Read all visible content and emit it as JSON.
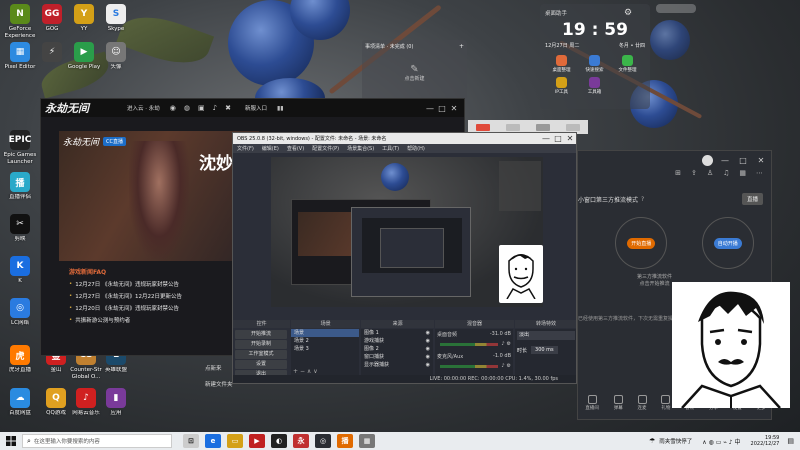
{
  "desktop": {
    "icons": [
      {
        "label": "GeForce\nExperience",
        "glyph": "N",
        "color": "#5a8a1a"
      },
      {
        "label": "GOG",
        "glyph": "GG",
        "color": "#c0202a"
      },
      {
        "label": "YY",
        "glyph": "Y",
        "color": "#d4a017"
      },
      {
        "label": "Skype",
        "glyph": "S",
        "color": "#eee"
      },
      {
        "label": "Pixel Editor",
        "glyph": "▦",
        "color": "#2d8ae0"
      },
      {
        "label": "",
        "glyph": "⚡",
        "color": "#444"
      },
      {
        "label": "Google Play",
        "glyph": "▶",
        "color": "#2a9d4a"
      },
      {
        "label": "头像",
        "glyph": "☺",
        "color": "#777"
      },
      {
        "label": "Epic Games\nLauncher",
        "glyph": "EPIC",
        "color": "#222"
      },
      {
        "label": "直播伴侣",
        "glyph": "播",
        "color": "#2aa9c9"
      },
      {
        "label": "剪映",
        "glyph": "✂",
        "color": "#111"
      },
      {
        "label": "K",
        "glyph": "K",
        "color": "#1a6ee0"
      },
      {
        "label": "LC网络",
        "glyph": "◎",
        "color": "#2a7be0"
      },
      {
        "label": "虎牙直播",
        "glyph": "虎",
        "color": "#ff7a00"
      },
      {
        "label": "金山",
        "glyph": "金",
        "color": "#d02020"
      },
      {
        "label": "Counter-Str\nGlobal O...",
        "glyph": "CS",
        "color": "#c08030"
      },
      {
        "label": "英雄联盟",
        "glyph": "L",
        "color": "#1b4a6b"
      },
      {
        "label": "百度网盘",
        "glyph": "☁",
        "color": "#2a8be0"
      },
      {
        "label": "QQ游戏",
        "glyph": "Q",
        "color": "#e0a020"
      },
      {
        "label": "网易云音乐",
        "glyph": "♪",
        "color": "#d02020"
      },
      {
        "label": "应用",
        "glyph": "▮",
        "color": "#7a3a9a"
      }
    ]
  },
  "clock_widget": {
    "title": "桌面助手",
    "time": "19 : 59",
    "date": "12月27日  周二",
    "sub": "冬月 • 廿四",
    "shortcuts": [
      "桌面整理",
      "快速搜索",
      "文件整理",
      "IP工具",
      "工具箱"
    ]
  },
  "notes_widget": {
    "title": "事项清单 · 未完成 (0)",
    "hint": "点击新建"
  },
  "game_launcher": {
    "logo": "永劫无间",
    "user": "进入云 · 永劫",
    "banner_text": "沈妙",
    "badge": "CC直播",
    "news_title": "游戏新闻FAQ",
    "news": [
      "12月27日 《永劫无间》违规玩家封禁公告",
      "12月27日 《永劫无间》12月22日更新公告",
      "12月20日 《永劫无间》违规玩家封禁公告",
      "共振新游公测与预约者"
    ],
    "side_btn": "新服入口",
    "engine": "unity"
  },
  "obs": {
    "title": "OBS 25.0.8 (32-bit, windows) - 配置文件: 未命名 - 场景: 未命名",
    "menu": [
      "文件(F)",
      "编辑(E)",
      "查看(V)",
      "配置文件(P)",
      "场景集合(S)",
      "工具(T)",
      "帮助(H)"
    ],
    "docks": [
      "场景",
      "来源",
      "混音器",
      "转场特效",
      "控件"
    ],
    "controls": [
      "开始推流",
      "开始录制",
      "工作室模式",
      "设置",
      "退出"
    ],
    "scenes": [
      "场景",
      "场景 2",
      "场景 3"
    ],
    "sources": [
      "图像 1",
      "游戏捕获",
      "图像 2",
      "窗口捕获",
      "显示器捕获"
    ],
    "mixer": [
      {
        "name": "桌面音频",
        "db": "-31.0 dB"
      },
      {
        "name": "麦克风/Aux",
        "db": "-1.0 dB"
      }
    ],
    "transition": {
      "name": "淡出",
      "duration_label": "时长",
      "duration": "300 ms"
    },
    "status": "LIVE: 00:00:00  REC: 00:00:00  CPU: 1.4%, 30.00 fps"
  },
  "stream_panel": {
    "mode": "小窗口第三方推流模式",
    "mode_badge": "直播",
    "start_btn": "开始直播",
    "auto_btn": "自动开播",
    "hint": "第三方推流软件\n点击开始推流",
    "note": "已经使用第三方推流软件，下次无需重复操作",
    "bottom_btns": [
      "直播间",
      "弹幕",
      "连麦",
      "礼物",
      "音效",
      "分享",
      "设置",
      "更多"
    ]
  },
  "extra_labels": {
    "new_label": "点新来",
    "new_label2": "新建文件夹"
  },
  "taskbar": {
    "search_placeholder": "在这里输入你要搜索的内容",
    "weather": "雨夹雪快停了",
    "time": "19:59",
    "date": "2022/12/27"
  },
  "colors": {
    "obs_bg": "#2b2e38",
    "accent": "#e06a00",
    "green": "#3bb54a"
  }
}
